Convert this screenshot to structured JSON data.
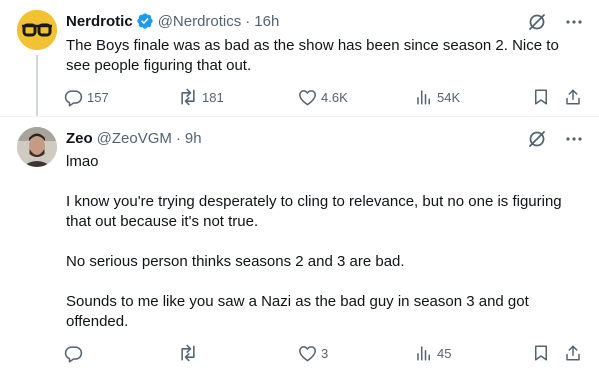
{
  "tweets": [
    {
      "name": "Nerdrotic",
      "verified": true,
      "handle": "@Nerdrotics",
      "dot": "·",
      "time": "16h",
      "lines": [
        "The Boys finale was as bad as the show has been since season 2. Nice to",
        "see people figuring that out."
      ],
      "replies": "157",
      "reposts": "181",
      "likes": "4.6K",
      "views": "54K"
    },
    {
      "name": "Zeo",
      "handle": "@ZeoVGM",
      "dot": "·",
      "time": "9h",
      "paragraphs": [
        [
          "lmao"
        ],
        [
          "I know you're trying desperately to cling to relevance, but no one is figuring",
          "that out because it's not true."
        ],
        [
          "No serious person thinks seasons 2 and 3 are bad."
        ],
        [
          "Sounds to me like you saw a Nazi as the bad guy in season 3 and got",
          "offended."
        ]
      ],
      "replies": "",
      "reposts": "",
      "likes": "3",
      "views": "45"
    }
  ],
  "colors": {
    "text": "#0f1419",
    "secondary": "#536471",
    "verified": "#1d9bf0",
    "divider": "#eff3f4",
    "thread_line": "#cfd9de"
  }
}
